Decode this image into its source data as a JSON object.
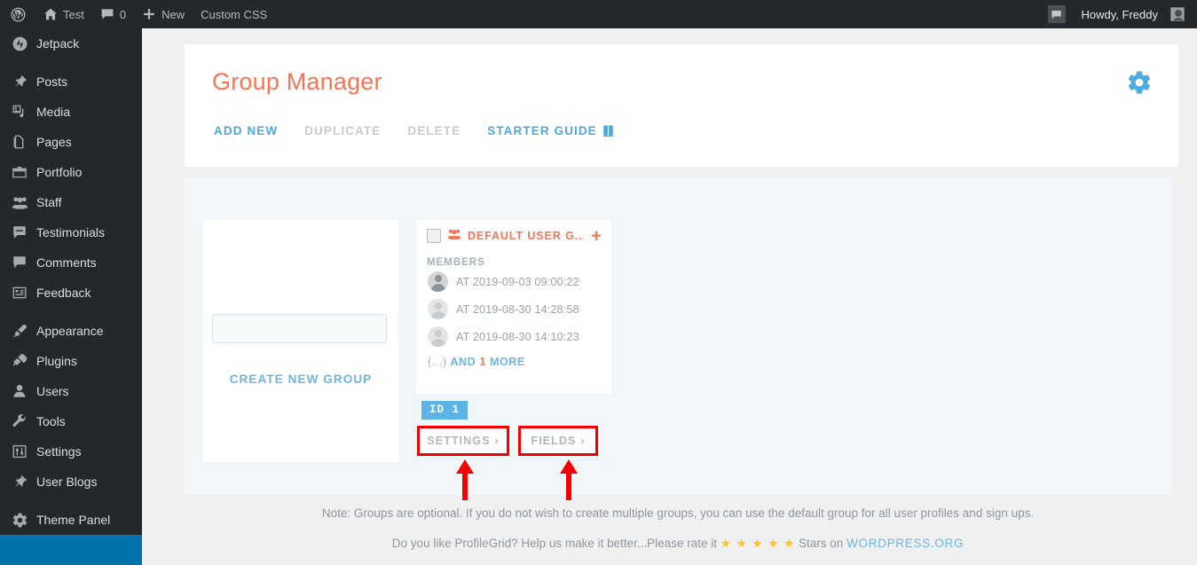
{
  "adminbar": {
    "logo_icon": "wordpress-logo-icon",
    "site_name": "Test",
    "home_icon": "home-icon",
    "comments_icon": "comment-bubble-icon",
    "comment_count": "0",
    "new_icon": "plus-icon",
    "new_label": "New",
    "custom_css_label": "Custom CSS",
    "notify_icon": "comment-bubble-icon",
    "howdy": "Howdy, Freddy",
    "avatar_icon": "user-avatar-icon"
  },
  "sidebar": {
    "items": [
      {
        "label": "Jetpack",
        "icon": "jetpack-icon",
        "gap_after": true
      },
      {
        "label": "Posts",
        "icon": "pin-icon",
        "gap_after": false
      },
      {
        "label": "Media",
        "icon": "media-icon",
        "gap_after": false
      },
      {
        "label": "Pages",
        "icon": "pages-icon",
        "gap_after": false
      },
      {
        "label": "Portfolio",
        "icon": "portfolio-icon",
        "gap_after": false
      },
      {
        "label": "Staff",
        "icon": "group-icon",
        "gap_after": false
      },
      {
        "label": "Testimonials",
        "icon": "quote-bubble-icon",
        "gap_after": false
      },
      {
        "label": "Comments",
        "icon": "comment-bubble-icon",
        "gap_after": false
      },
      {
        "label": "Feedback",
        "icon": "feedback-icon",
        "gap_after": true
      },
      {
        "label": "Appearance",
        "icon": "paintbrush-icon",
        "gap_after": false
      },
      {
        "label": "Plugins",
        "icon": "plug-icon",
        "gap_after": false
      },
      {
        "label": "Users",
        "icon": "user-icon",
        "gap_after": false
      },
      {
        "label": "Tools",
        "icon": "wrench-icon",
        "gap_after": false
      },
      {
        "label": "Settings",
        "icon": "sliders-icon",
        "gap_after": false
      },
      {
        "label": "User Blogs",
        "icon": "pin-icon",
        "gap_after": true
      },
      {
        "label": "Theme Panel",
        "icon": "gear-icon",
        "gap_after": false
      }
    ]
  },
  "header": {
    "title": "Group Manager",
    "gear_icon": "gear-icon",
    "tabs": [
      {
        "label": "ADD NEW",
        "state": "blue"
      },
      {
        "label": "DUPLICATE",
        "state": "gray"
      },
      {
        "label": "DELETE",
        "state": "gray"
      },
      {
        "label": "STARTER GUIDE",
        "state": "blue",
        "icon": "book-icon"
      }
    ]
  },
  "create_card": {
    "input_value": "",
    "input_placeholder": "",
    "button_label": "CREATE NEW GROUP"
  },
  "group_card": {
    "checkbox_checked": false,
    "group_icon": "users-group-icon",
    "title": "DEFAULT USER G...",
    "add_icon": "plus-icon",
    "members_label": "MEMBERS",
    "members": [
      {
        "avatar": "user-avatar-icon",
        "text": "AT 2019-09-03 09:00:22"
      },
      {
        "avatar": "user-avatar-icon",
        "text": "AT 2019-08-30 14:28:58"
      },
      {
        "avatar": "user-avatar-icon",
        "text": "AT 2019-08-30 14:10:23"
      }
    ],
    "more_prefix": "(...)",
    "more_and": "AND",
    "more_count": "1",
    "more_suffix": "MORE",
    "id_badge": "ID 1",
    "settings_label": "SETTINGS",
    "fields_label": "FIELDS",
    "chevron": "›"
  },
  "annotations": {
    "color": "#f50000",
    "settings_arrow": "up-arrow-annotation",
    "fields_arrow": "up-arrow-annotation"
  },
  "footer": {
    "note": "Note: Groups are optional. If you do not wish to create multiple groups, you can use the default group for all user profiles and sign ups.",
    "rate_prefix": "Do you like ProfileGrid? Help us make it better...Please rate it",
    "stars": "★ ★ ★ ★ ★",
    "rate_mid": "Stars on",
    "wporg_link": "WORDPRESS.ORG"
  },
  "colors": {
    "accent_orange": "#fc7354",
    "accent_blue": "#50a7e0",
    "badge_blue": "#5ab4e6",
    "annotation_red": "#f50000",
    "star_yellow": "#ffc31f",
    "adminbar_bg": "#23282d"
  }
}
